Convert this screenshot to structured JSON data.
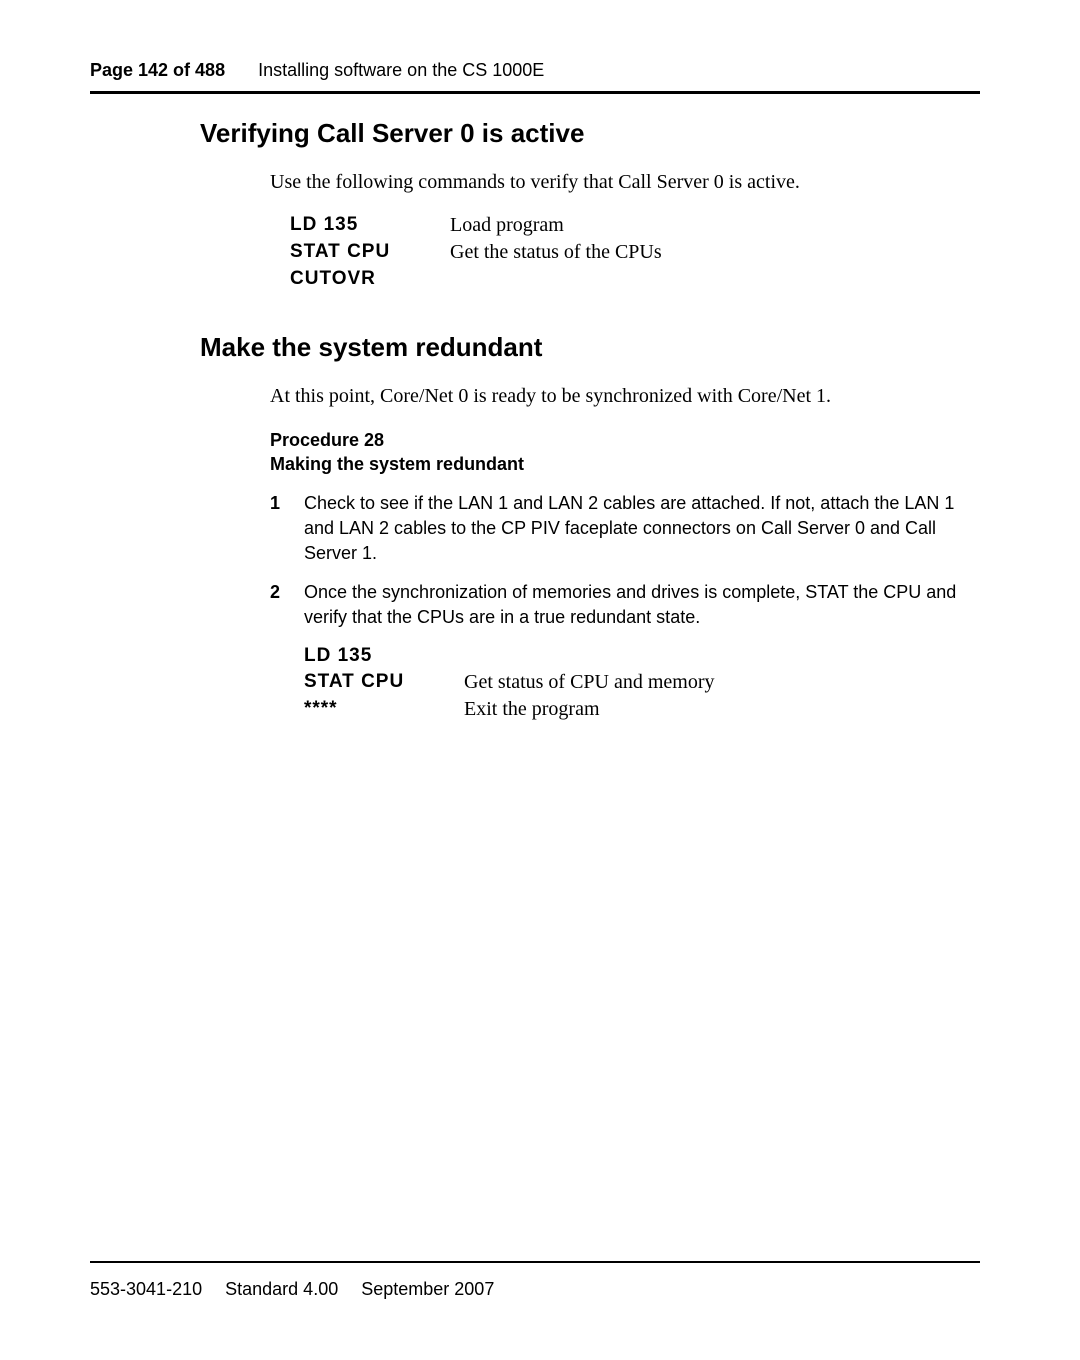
{
  "header": {
    "page_label": "Page 142 of 488",
    "section_title": "Installing software on the CS 1000E"
  },
  "section1": {
    "heading": "Verifying Call Server 0 is active",
    "intro": "Use the following commands to verify that Call Server 0 is active.",
    "commands": [
      {
        "cmd": "LD 135",
        "desc": "Load program"
      },
      {
        "cmd": "STAT CPU",
        "desc": "Get the status of the CPUs"
      },
      {
        "cmd": "CUTOVR",
        "desc": ""
      }
    ]
  },
  "section2": {
    "heading": "Make the system redundant",
    "intro": "At this point, Core/Net 0 is ready to be synchronized with Core/Net 1.",
    "procedure_label": "Procedure 28",
    "procedure_title": "Making the system redundant",
    "steps": [
      {
        "num": "1",
        "text": "Check to see if the LAN 1 and LAN 2 cables are attached. If not, attach the LAN 1 and LAN 2 cables to the CP PIV faceplate connectors on Call Server 0 and Call Server 1."
      },
      {
        "num": "2",
        "text": "Once the synchronization of memories and drives is complete, STAT the CPU and verify that the CPUs are in a true redundant state."
      }
    ],
    "commands": [
      {
        "cmd": "LD 135",
        "desc": ""
      },
      {
        "cmd": "STAT CPU",
        "desc": "Get status of CPU and memory"
      },
      {
        "cmd": "****",
        "desc": "Exit the program"
      }
    ]
  },
  "footer": {
    "doc_num": "553-3041-210",
    "version": "Standard 4.00",
    "date": "September 2007"
  }
}
